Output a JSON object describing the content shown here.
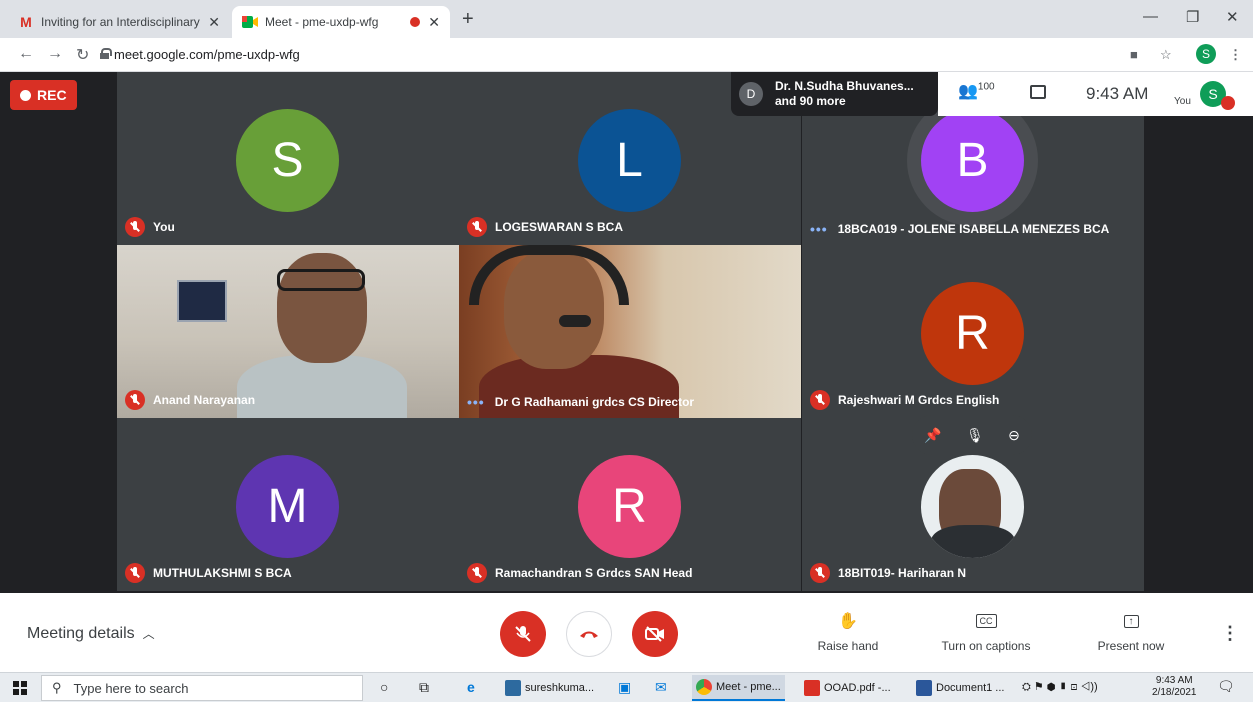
{
  "browser": {
    "tabs": [
      {
        "title": "Inviting for an Interdisciplinary R",
        "icon": "gmail-icon",
        "active": false
      },
      {
        "title": "Meet - pme-uxdp-wfg",
        "icon": "meet-icon",
        "active": true,
        "recording": true
      }
    ],
    "new_tab": "+",
    "url": "meet.google.com/pme-uxdp-wfg",
    "profile_initial": "S"
  },
  "meet": {
    "rec_label": "REC",
    "participants_summary": {
      "initial": "D",
      "line1": "Dr. N.Sudha Bhuvanes...",
      "line2": "and 90 more"
    },
    "people_count": "100",
    "time": "9:43 AM",
    "you_label": "You",
    "self_initial": "S",
    "tiles": [
      {
        "name": "You",
        "initial": "S",
        "color": "#689f38",
        "muted": true
      },
      {
        "name": "LOGESWARAN S BCA",
        "initial": "L",
        "color": "#0b5394",
        "muted": true
      },
      {
        "name": "18BCA019 - JOLENE ISABELLA MENEZES BCA",
        "initial": "B",
        "color": "#a142f4",
        "muted": false
      },
      {
        "name": "Anand Narayanan",
        "muted": true,
        "video": true
      },
      {
        "name": "Dr G Radhamani grdcs CS Director",
        "muted": false,
        "video": true
      },
      {
        "name": "Rajeshwari M Grdcs English",
        "initial": "R",
        "color": "#bf360c",
        "muted": true
      },
      {
        "name": "MUTHULAKSHMI S BCA",
        "initial": "M",
        "color": "#5e35b1",
        "muted": true
      },
      {
        "name": "Ramachandran S Grdcs SAN Head",
        "initial": "R",
        "color": "#e8457a",
        "muted": true
      },
      {
        "name": "18BIT019- Hariharan N",
        "muted": true,
        "photo": true
      }
    ]
  },
  "controls": {
    "meeting_details": "Meeting details",
    "raise_hand": "Raise hand",
    "captions": "Turn on captions",
    "present": "Present now"
  },
  "taskbar": {
    "search_placeholder": "Type here to search",
    "apps": [
      "sureshkuma...",
      "Meet - pme...",
      "OOAD.pdf -...",
      "Document1 ..."
    ],
    "clock_time": "9:43 AM",
    "clock_date": "2/18/2021"
  }
}
